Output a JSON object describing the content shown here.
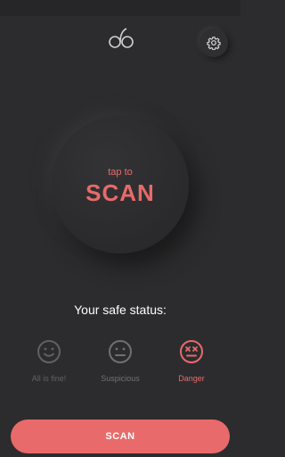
{
  "header": {
    "logo_icon": "double-c-logo-icon",
    "settings_icon": "gear-icon"
  },
  "scan": {
    "sub_label": "tap to",
    "main_label": "SCAN"
  },
  "status": {
    "title": "Your safe status:",
    "options": [
      {
        "label": "All is fine!",
        "icon": "smile-face-icon",
        "active": false
      },
      {
        "label": "Suspicious",
        "icon": "neutral-face-icon",
        "active": false
      },
      {
        "label": "Danger",
        "icon": "dizzy-face-icon",
        "active": true
      }
    ]
  },
  "footer": {
    "scan_button_label": "SCAN"
  },
  "colors": {
    "background": "#2c2c2e",
    "accent": "#e86a6a",
    "muted": "#616164"
  }
}
